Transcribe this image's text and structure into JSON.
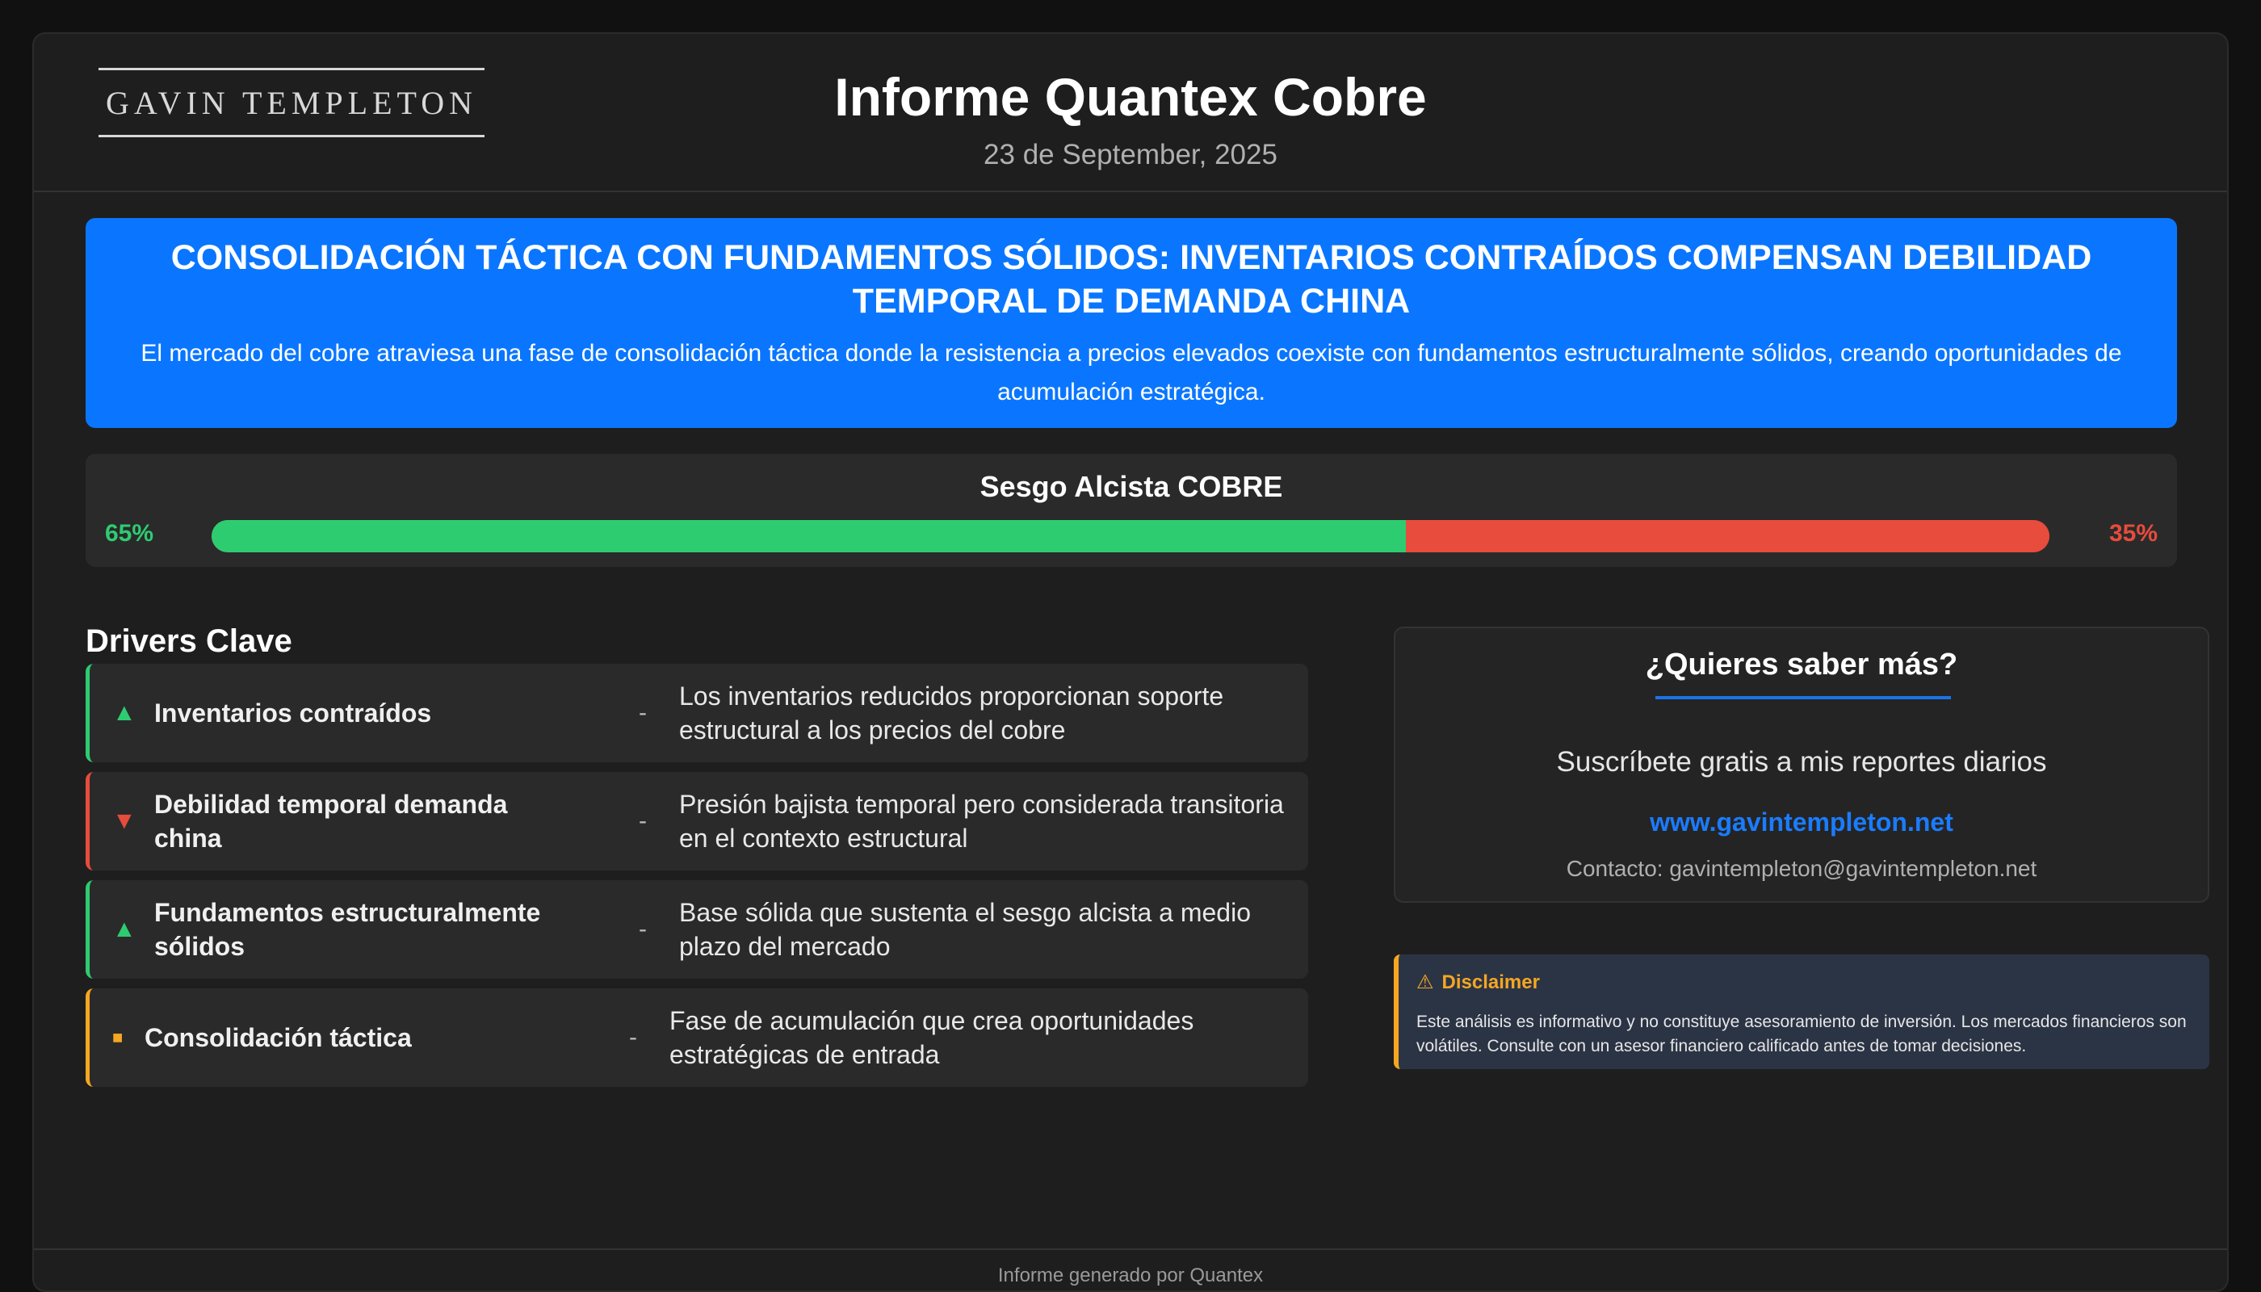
{
  "header": {
    "logo_text": "GAVIN TEMPLETON",
    "title": "Informe Quantex Cobre",
    "date": "23 de September, 2025"
  },
  "headline": {
    "title": "CONSOLIDACIÓN TÁCTICA CON FUNDAMENTOS SÓLIDOS: INVENTARIOS CONTRAÍDOS COMPENSAN DEBILIDAD TEMPORAL DE DEMANDA CHINA",
    "summary": "El mercado del cobre atraviesa una fase de consolidación táctica donde la resistencia a precios elevados coexiste con fundamentos estructuralmente sólidos, creando oportunidades de acumulación estratégica."
  },
  "bias": {
    "title": "Sesgo Alcista COBRE",
    "bullish_label": "65%",
    "bearish_label": "35%",
    "bullish_value": 65,
    "bearish_value": 35,
    "colors": {
      "bullish": "#2ecc71",
      "bearish": "#e74c3c"
    }
  },
  "drivers": {
    "title": "Drivers Clave",
    "items": [
      {
        "icon": "▲",
        "icon_name": "triangle-up-icon",
        "direction": "up",
        "name": "Inventarios contraídos",
        "separator": "-",
        "description": "Los inventarios reducidos proporcionan soporte estructural a los precios del cobre"
      },
      {
        "icon": "▼",
        "icon_name": "triangle-down-icon",
        "direction": "down",
        "name": "Debilidad temporal demanda china",
        "separator": "-",
        "description": "Presión bajista temporal pero considerada transitoria en el contexto estructural"
      },
      {
        "icon": "▲",
        "icon_name": "triangle-up-icon",
        "direction": "up",
        "name": "Fundamentos estructuralmente sólidos",
        "separator": "-",
        "description": "Base sólida que sustenta el sesgo alcista a medio plazo del mercado"
      },
      {
        "icon": "■",
        "icon_name": "square-icon",
        "direction": "neutral",
        "name": "Consolidación táctica",
        "separator": "-",
        "description": "Fase de acumulación que crea oportunidades estratégicas de entrada"
      }
    ]
  },
  "cta": {
    "title": "¿Quieres saber más?",
    "subtitle": "Suscríbete gratis a mis reportes diarios",
    "link_text": "www.gavintempleton.net",
    "contact": "Contacto: gavintempleton@gavintempleton.net"
  },
  "disclaimer": {
    "icon": "⚠",
    "title": "Disclaimer",
    "text": "Este análisis es informativo y no constituye asesoramiento de inversión. Los mercados financieros son volátiles. Consulte con un asesor financiero calificado antes de tomar decisiones."
  },
  "footer": {
    "text": "Informe generado por Quantex"
  },
  "colors": {
    "accent_blue": "#0a76ff",
    "up": "#2ecc71",
    "down": "#e74c3c",
    "neutral": "#f5a623"
  }
}
